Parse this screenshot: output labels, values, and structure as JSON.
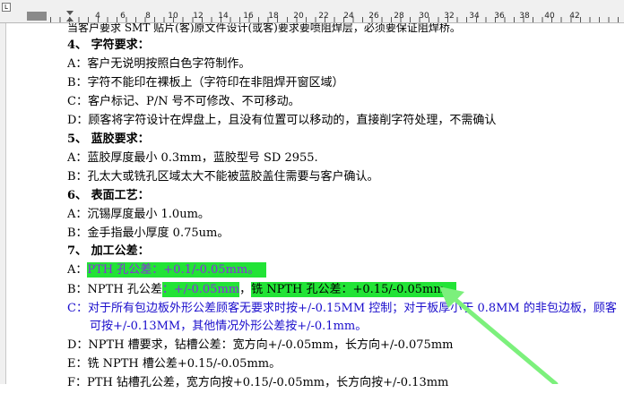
{
  "ruler": {
    "numbers": [
      "4",
      "6",
      "8",
      "10",
      "12",
      "14",
      "16",
      "18",
      "20",
      "22",
      "24",
      "26",
      "28",
      "30",
      "32",
      "34",
      "36",
      "38",
      "40",
      "42"
    ]
  },
  "doc": {
    "line_top": "当客户要求 SMT 贴片(客)原文件设计(或客)要求要喷阻焊层，必须要保证阻焊桥。",
    "s4_title": "4、 字符要求：",
    "s4_a": "A：客户无说明按照白色字符制作。",
    "s4_b": "B：字符不能印在裸板上（字符印在非阻焊开窗区域）",
    "s4_c": "C：客户标记、P/N 号不可修改、不可移动。",
    "s4_d": "D：顾客将字符设计在焊盘上，且没有位置可以移动的，直接削字符处理，不需确认",
    "s5_title": "5、 蓝胶要求：",
    "s5_a": "A：蓝胶厚度最小 0.3mm，蓝胶型号 SD 2955.",
    "s5_b": "B：孔太大或铣孔区域太大不能被蓝胶盖住需要与客户确认。",
    "s6_title": "6、 表面工艺：",
    "s6_a": "A：沉锡厚度最小 1.0um。",
    "s6_b": "B：金手指最小厚度 0.75um。",
    "s7_title": "7、 加工公差：",
    "s7_a_prefix": "A：",
    "s7_a_hl": "PTH 孔公差：+0.1/-0.05mm。",
    "s7_b_prefix": "B：NPTH 孔公差",
    "s7_b_hl1": "：+/-0.05mm",
    "s7_b_mid": "，",
    "s7_b_hl2": "铣 NPTH 孔公差：+0.15/-0.05mm。",
    "s7_c1": "C：对于所有包边板外形公差顾客无要求时按+/-0.15MM 控制；对于板厚小于 0.8MM 的非包边板，顾客",
    "s7_c2": "可按+/-0.13MM，其他情况外形公差按+/-0.1mm。",
    "s7_d": "D：NPTH 槽要求，钻槽公差：宽方向+/-0.05mm，长方向+/-0.075mm",
    "s7_e": "E：铣 NPTH 槽公差+0.15/-0.05mm。",
    "s7_f": "F：PTH 钻槽孔公差，宽方向按+0.15/-0.05mm，长方向按+/-0.13mm"
  },
  "colors": {
    "highlight": "#22e336",
    "blue_text": "#1a0dcc",
    "arrow": "#7cf07c"
  }
}
